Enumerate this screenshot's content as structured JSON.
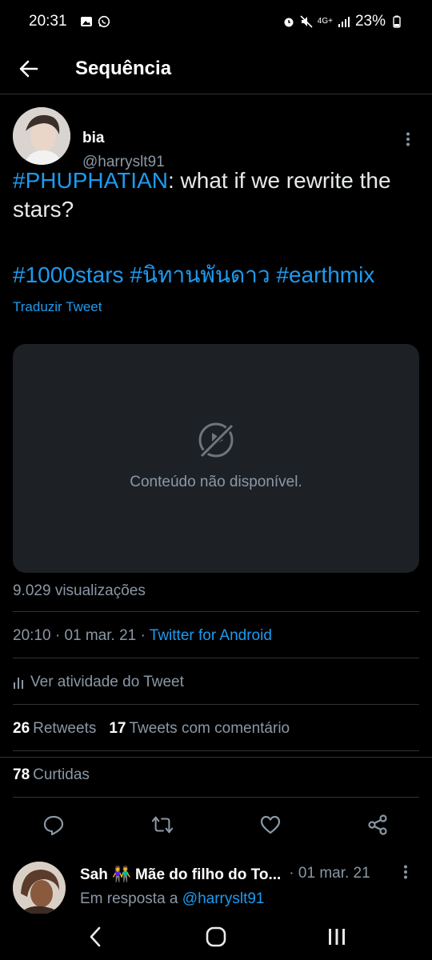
{
  "status_bar": {
    "time": "20:31",
    "network": "4G+",
    "battery": "23%",
    "left_icons": [
      "gallery-icon",
      "whatsapp-icon"
    ],
    "right_icons": [
      "alarm-icon",
      "mute-icon",
      "network-icon",
      "signal-icon",
      "battery-icon"
    ]
  },
  "header": {
    "back_icon": "arrow-left-icon",
    "title": "Sequência"
  },
  "tweet": {
    "author_name": "bia",
    "author_handle": "@harryslt91",
    "text_hashtag": "#PHUPHATIAN",
    "text_body": ": what if we rewrite the stars?",
    "hashtags": [
      "#1000stars",
      "#นิทานพันดาว",
      "#earthmix"
    ],
    "translate_label": "Traduzir Tweet",
    "media_unavailable": "Conteúdo não disponível.",
    "views": "9.029 visualizações",
    "time": "20:10",
    "date": "01 mar. 21",
    "source": "Twitter for Android",
    "activity_label": "Ver atividade do Tweet",
    "retweets_count": "26",
    "retweets_label": "Retweets",
    "quotes_count": "17",
    "quotes_label": "Tweets com comentário",
    "likes_count": "78",
    "likes_label": "Curtidas",
    "action_icons": [
      "reply-icon",
      "retweet-icon",
      "like-icon",
      "share-icon"
    ]
  },
  "reply": {
    "name": "Sah 👫 Mãe do filho do To...",
    "date": "· 01 mar. 21",
    "replying_prefix": "Em resposta a ",
    "replying_to": "@harryslt91"
  },
  "nav": {
    "icons": [
      "back-nav-icon",
      "home-nav-icon",
      "recents-nav-icon"
    ]
  },
  "colors": {
    "background": "#000000",
    "accent": "#1d9bf0",
    "muted": "#8b98a5",
    "media_bg": "#1d2126",
    "divider": "#2f3336"
  }
}
